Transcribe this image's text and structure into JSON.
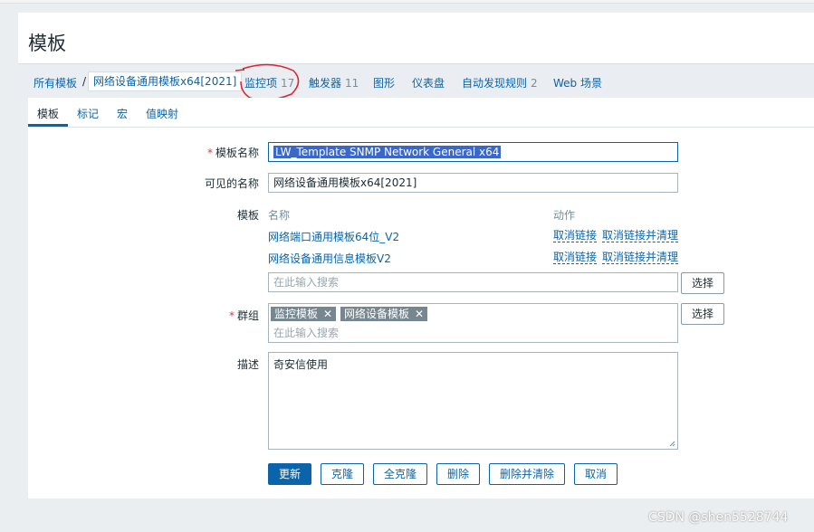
{
  "page_title": "模板",
  "nav": {
    "all_templates": "所有模板",
    "current_template": "网络设备通用模板x64[2021]",
    "items_label": "监控项",
    "items_count": "17",
    "triggers_label": "触发器",
    "triggers_count": "11",
    "graphs_label": "图形",
    "dashboards_label": "仪表盘",
    "discovery_label": "自动发现规则",
    "discovery_count": "2",
    "web_label": "Web 场景"
  },
  "tabs": [
    "模板",
    "标记",
    "宏",
    "值映射"
  ],
  "form": {
    "template_name_label": "模板名称",
    "template_name_value": "LW_Template SNMP  Network General x64",
    "visible_name_label": "可见的名称",
    "visible_name_value": "网络设备通用模板x64[2021]",
    "templates_label": "模板",
    "col_name": "名称",
    "col_action": "动作",
    "linked_templates": [
      {
        "name": "网络端口通用模板64位_V2",
        "unlink": "取消链接",
        "unlink_clear": "取消链接并清理"
      },
      {
        "name": "网络设备通用信息模板V2",
        "unlink": "取消链接",
        "unlink_clear": "取消链接并清理"
      }
    ],
    "search_placeholder": "在此输入搜索",
    "select_button": "选择",
    "groups_label": "群组",
    "groups": [
      "监控模板",
      "网络设备模板"
    ],
    "groups_placeholder": "在此输入搜索",
    "description_label": "描述",
    "description_value": "奇安信使用"
  },
  "buttons": {
    "update": "更新",
    "clone": "克隆",
    "full_clone": "全克隆",
    "delete": "删除",
    "delete_clear": "删除并清除",
    "cancel": "取消"
  },
  "watermark": "CSDN @shen5528744",
  "colors": {
    "accent": "#0b64a9",
    "required": "#e33734",
    "annotation": "#e0202a"
  }
}
